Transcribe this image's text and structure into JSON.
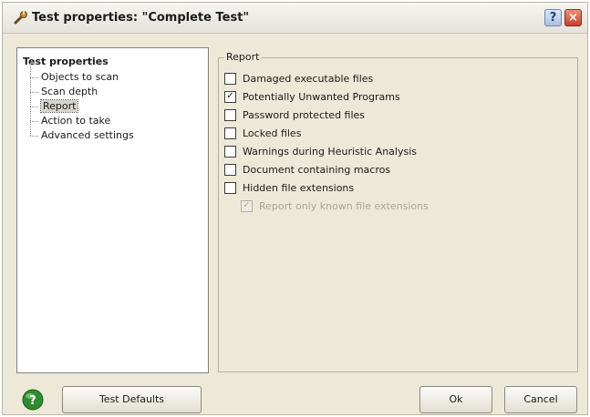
{
  "window": {
    "title": "Test properties: \"Complete Test\"",
    "help_label": "?",
    "close_label": "×",
    "icon": "wrench-icon"
  },
  "tree": {
    "root": "Test properties",
    "items": [
      {
        "label": "Objects to scan",
        "selected": false
      },
      {
        "label": "Scan depth",
        "selected": false
      },
      {
        "label": "Report",
        "selected": true
      },
      {
        "label": "Action to take",
        "selected": false
      },
      {
        "label": "Advanced settings",
        "selected": false
      }
    ]
  },
  "report": {
    "group_label": "Report",
    "options": [
      {
        "label": "Damaged executable files",
        "checked": false
      },
      {
        "label": "Potentially Unwanted Programs",
        "checked": true
      },
      {
        "label": "Password protected files",
        "checked": false
      },
      {
        "label": "Locked files",
        "checked": false
      },
      {
        "label": "Warnings during Heuristic Analysis",
        "checked": false
      },
      {
        "label": "Document containing macros",
        "checked": false
      },
      {
        "label": "Hidden file extensions",
        "checked": false
      }
    ],
    "sub_option": {
      "label": "Report only known file extensions",
      "checked": true,
      "disabled": true
    }
  },
  "buttons": {
    "default": "Test Defaults",
    "ok": "Ok",
    "cancel": "Cancel"
  },
  "colors": {
    "dialog_bg": "#ece9d8",
    "help_globe": "#2e8b2e"
  }
}
